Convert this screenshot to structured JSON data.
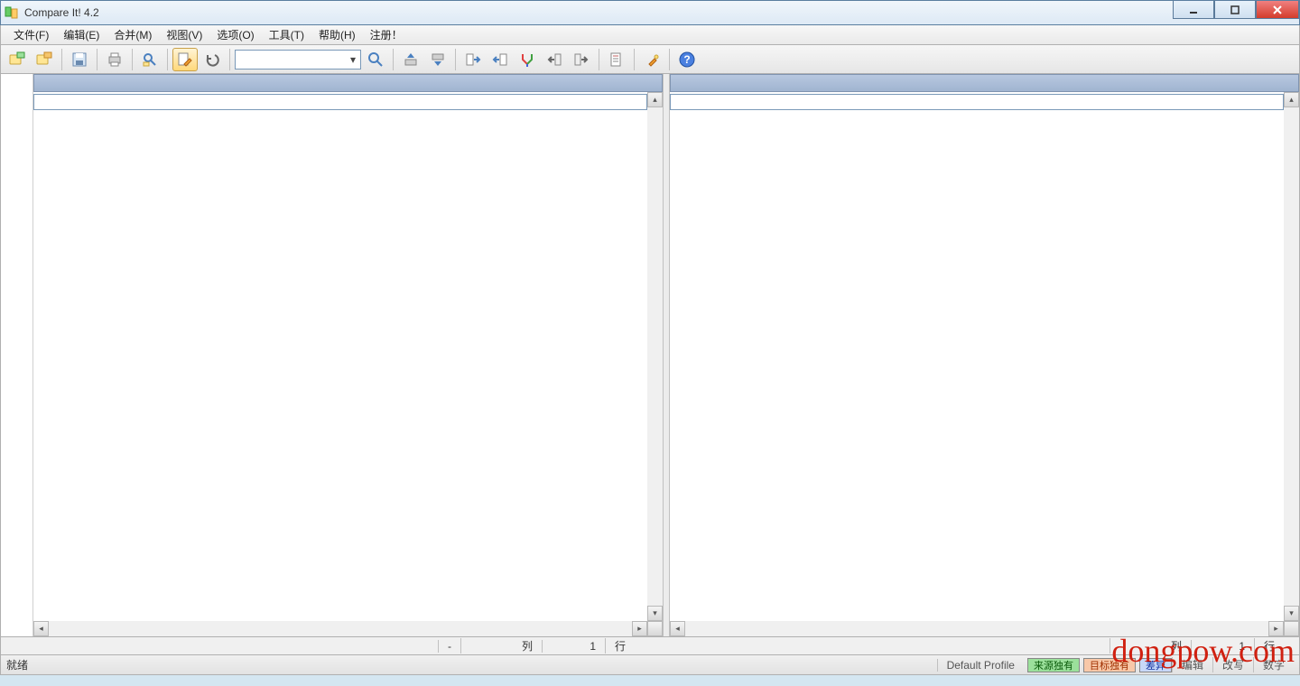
{
  "title": "Compare It! 4.2",
  "menu": {
    "file": "文件(F)",
    "edit": "编辑(E)",
    "merge": "合并(M)",
    "view": "视图(V)",
    "options": "选项(O)",
    "tools": "工具(T)",
    "help": "帮助(H)",
    "register": "注册！"
  },
  "toolbar": {
    "search_value": ""
  },
  "ruler": {
    "dash": "-",
    "col_label": "列",
    "col_value": "1",
    "row_label": "行",
    "col_label_r": "列",
    "col_value_r": "1",
    "row_label_r": "行"
  },
  "status": {
    "ready": "就绪",
    "profile": "Default Profile",
    "source_only": "来源独有",
    "target_only": "目标独有",
    "diff": "差异",
    "edited": "编辑",
    "overwrite": "改写",
    "num": "数字"
  },
  "watermark": "dongpow.com"
}
